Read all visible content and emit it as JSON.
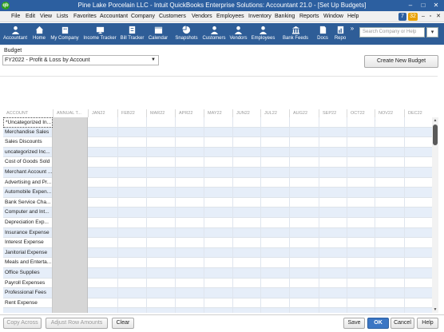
{
  "window": {
    "title": "Pine Lake Porcelain LLC  - Intuit QuickBooks Enterprise Solutions: Accountant 21.0 - [Set Up Budgets]",
    "logo_text": "qb",
    "controls": [
      "–",
      "□",
      "✕"
    ]
  },
  "menu": {
    "items": [
      "File",
      "Edit",
      "View",
      "Lists",
      "Favorites",
      "Accountant",
      "Company",
      "Customers",
      "Vendors",
      "Employees",
      "Inventory",
      "Banking",
      "Reports",
      "Window",
      "Help"
    ],
    "notification_count": "7",
    "time": "32",
    "window_controls": [
      "–",
      "▫",
      "✕"
    ]
  },
  "toolbar": {
    "items": [
      {
        "label": "Accountant",
        "icon": "accountant-icon"
      },
      {
        "label": "Home",
        "icon": "home-icon"
      },
      {
        "label": "My Company",
        "icon": "my-company-icon"
      },
      {
        "label": "Income Tracker",
        "icon": "income-tracker-icon"
      },
      {
        "label": "Bill Tracker",
        "icon": "bill-tracker-icon"
      },
      {
        "label": "Calendar",
        "icon": "calendar-icon"
      },
      {
        "label": "Snapshots",
        "icon": "snapshots-icon"
      },
      {
        "label": "Customers",
        "icon": "customers-icon"
      },
      {
        "label": "Vendors",
        "icon": "vendors-icon"
      },
      {
        "label": "Employees",
        "icon": "employees-icon"
      },
      {
        "label": "Bank Feeds",
        "icon": "bank-feeds-icon"
      },
      {
        "label": "Docs",
        "icon": "docs-icon"
      },
      {
        "label": "Repo",
        "icon": "reports-icon"
      }
    ],
    "more": "»",
    "search_placeholder": "Search Company or Help",
    "search_button": "▾"
  },
  "budget": {
    "label": "Budget",
    "selected": "FY2022 - Profit & Loss by Account",
    "create_button": "Create New Budget"
  },
  "grid": {
    "columns": [
      "ACCOUNT",
      "ANNUAL T...",
      "JAN22",
      "FEB22",
      "MAR22",
      "APR22",
      "MAY22",
      "JUN22",
      "JUL22",
      "AUG22",
      "SEP22",
      "OCT22",
      "NOV22",
      "DEC22"
    ],
    "rows": [
      "*Uncategorized In...",
      "Merchandise Sales",
      "Sales Discounts",
      "uncategorized Inc...",
      "Cost of Goods Sold",
      "Merchant Account ...",
      "Advertising and Pr...",
      "Automobile Expen...",
      "Bank Service Cha...",
      "Computer and Int...",
      "Depreciation Exp...",
      "Insurance Expense",
      "Interest Expense",
      "Janitorial Expense",
      "Meals and Enterta...",
      "Office Supplies",
      "Payroll Expenses",
      "Professional Fees",
      "Rent Expense",
      ""
    ]
  },
  "footer": {
    "copy_across": "Copy Across",
    "adjust_row_amounts": "Adjust Row Amounts",
    "clear": "Clear",
    "save": "Save",
    "ok": "OK",
    "cancel": "Cancel",
    "help": "Help"
  },
  "colors": {
    "title_bar": "#2c5fa0",
    "icon_bar": "#2e5d97",
    "row_alt": "#e6eef9",
    "ok_button": "#3b76c4"
  }
}
